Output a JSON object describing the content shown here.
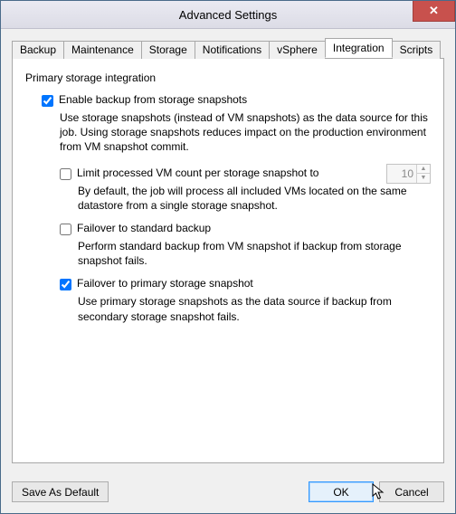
{
  "window": {
    "title": "Advanced Settings"
  },
  "tabs": {
    "items": [
      {
        "label": "Backup"
      },
      {
        "label": "Maintenance"
      },
      {
        "label": "Storage"
      },
      {
        "label": "Notifications"
      },
      {
        "label": "vSphere"
      },
      {
        "label": "Integration"
      },
      {
        "label": "Scripts"
      }
    ],
    "activeIndex": 5
  },
  "panel": {
    "groupLabel": "Primary storage integration",
    "enable": {
      "checked": true,
      "label": "Enable backup from storage snapshots",
      "desc": "Use storage snapshots (instead of VM snapshots) as the data source for this job. Using storage snapshots reduces impact on the production environment from VM snapshot commit."
    },
    "limit": {
      "checked": false,
      "label": "Limit processed VM count per storage snapshot to",
      "value": "10",
      "desc": "By default, the job will process all included VMs located on the same datastore from a single storage snapshot."
    },
    "failoverStandard": {
      "checked": false,
      "label": "Failover to standard backup",
      "desc": "Perform standard backup from VM snapshot if backup from storage snapshot fails."
    },
    "failoverPrimary": {
      "checked": true,
      "label": "Failover to primary storage snapshot",
      "desc": "Use primary storage snapshots as the data source if backup from secondary storage snapshot fails."
    }
  },
  "buttons": {
    "saveAsDefault": "Save As Default",
    "ok": "OK",
    "cancel": "Cancel"
  }
}
